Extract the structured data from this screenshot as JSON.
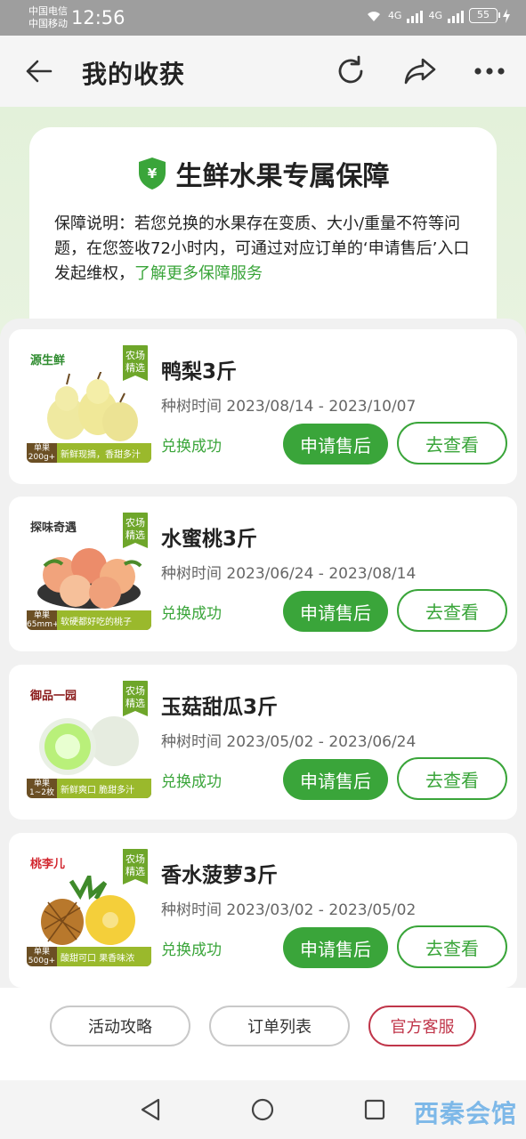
{
  "status_bar": {
    "carrier1": "中国电信",
    "carrier2": "中国移动",
    "time": "12:56",
    "net1": "4G",
    "net2": "4G",
    "battery": "55"
  },
  "header": {
    "title": "我的收获",
    "back_icon": "back-arrow-icon",
    "refresh_icon": "refresh-icon",
    "share_icon": "share-icon",
    "more_icon": "more-dots-icon"
  },
  "guarantee": {
    "title": "生鲜水果专属保障",
    "shield_symbol": "¥",
    "text": "保障说明：若您兑换的水果存在变质、大小/重量不符等问题，在您签收72小时内，可通过对应订单的‘申请售后’入口发起维权，",
    "link": "了解更多保障服务"
  },
  "items": [
    {
      "brand": "源生鲜",
      "badge": "农场精选",
      "spec": "单果200g+",
      "desc": "新鲜现摘，香甜多汁",
      "name": "鸭梨3斤",
      "period": "种树时间 2023/08/14 - 2023/10/07",
      "status": "兑换成功",
      "after_sale": "申请售后",
      "view": "去查看",
      "fruit": "pear"
    },
    {
      "brand": "探味奇遇",
      "badge": "农场精选",
      "spec": "单果65mm+",
      "desc": "软硬都好吃的桃子",
      "name": "水蜜桃3斤",
      "period": "种树时间 2023/06/24 - 2023/08/14",
      "status": "兑换成功",
      "after_sale": "申请售后",
      "view": "去查看",
      "fruit": "peach"
    },
    {
      "brand": "御品一园",
      "badge": "农场精选",
      "spec": "单果1~2枚",
      "desc": "新鲜爽口 脆甜多汁",
      "name": "玉菇甜瓜3斤",
      "period": "种树时间 2023/05/02 - 2023/06/24",
      "status": "兑换成功",
      "after_sale": "申请售后",
      "view": "去查看",
      "fruit": "melon"
    },
    {
      "brand": "桃李儿",
      "badge": "农场精选",
      "spec": "单果500g+",
      "desc": "酸甜可口 果香味浓",
      "name": "香水菠萝3斤",
      "period": "种树时间 2023/03/02 - 2023/05/02",
      "status": "兑换成功",
      "after_sale": "申请售后",
      "view": "去查看",
      "fruit": "pineapple"
    }
  ],
  "bottom": {
    "guide": "活动攻略",
    "orders": "订单列表",
    "service": "官方客服"
  },
  "navbar": {
    "watermark": "西秦会馆"
  },
  "colors": {
    "accent": "#3aa53a",
    "service": "#c0364a"
  }
}
